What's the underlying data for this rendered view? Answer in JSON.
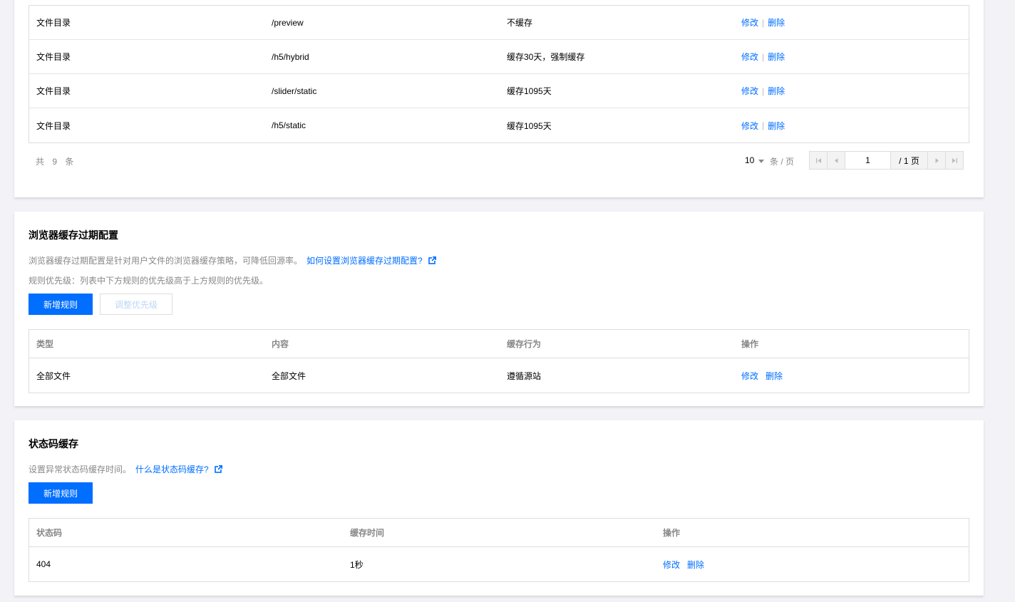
{
  "section1": {
    "rows": [
      {
        "type": "文件目录",
        "content": "/preview",
        "behavior": "不缓存"
      },
      {
        "type": "文件目录",
        "content": "/h5/hybrid",
        "behavior": "缓存30天，强制缓存"
      },
      {
        "type": "文件目录",
        "content": "/slider/static",
        "behavior": "缓存1095天"
      },
      {
        "type": "文件目录",
        "content": "/h5/static",
        "behavior": "缓存1095天"
      }
    ],
    "actions": {
      "edit": "修改",
      "sep": "|",
      "delete": "删除"
    },
    "pagination": {
      "total_label": "共 9 条",
      "page_size": "10",
      "per_page_label": "条 / 页",
      "current_page": "1",
      "total_pages_label": "/ 1 页"
    }
  },
  "section2": {
    "title": "浏览器缓存过期配置",
    "desc": "浏览器缓存过期配置是针对用户文件的浏览器缓存策略，可降低回源率。",
    "help_link": "如何设置浏览器缓存过期配置?",
    "priority_note": "规则优先级：列表中下方规则的优先级高于上方规则的优先级。",
    "add_button": "新增规则",
    "adjust_button": "调整优先级",
    "columns": [
      "类型",
      "内容",
      "缓存行为",
      "操作"
    ],
    "rows": [
      {
        "type": "全部文件",
        "content": "全部文件",
        "behavior": "遵循源站"
      }
    ],
    "actions": {
      "edit": "修改",
      "delete": "删除"
    }
  },
  "section3": {
    "title": "状态码缓存",
    "desc": "设置异常状态码缓存时间。",
    "help_link": "什么是状态码缓存?",
    "add_button": "新增规则",
    "columns": [
      "状态码",
      "缓存时间",
      "操作"
    ],
    "rows": [
      {
        "code": "404",
        "time": "1秒"
      }
    ],
    "actions": {
      "edit": "修改",
      "delete": "删除"
    }
  },
  "colors": {
    "primary": "#006eff",
    "muted_text": "#888888",
    "border": "#dddddd",
    "background": "#f2f2f7"
  },
  "icons": {
    "external_link": "external-link-icon",
    "first_page": "first-page-icon",
    "prev_page": "prev-page-icon",
    "next_page": "next-page-icon",
    "last_page": "last-page-icon",
    "dropdown": "chevron-down-icon"
  }
}
